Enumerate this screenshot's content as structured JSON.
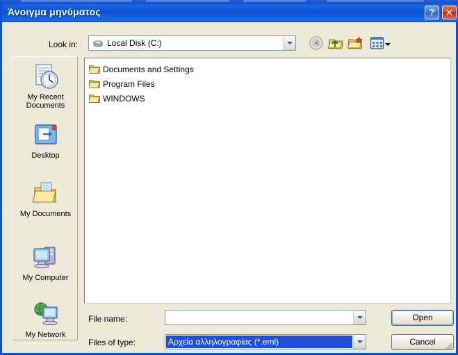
{
  "window": {
    "title": "Άνοιγμα μηνύματος",
    "help_button_label": "?",
    "close_button_label": "✕",
    "accent_color": "#0a4fd4",
    "titlebar_color": "#0b52cf"
  },
  "toolbar": {
    "lookin_label": "Look in:",
    "lookin_value": "Local Disk (C:)",
    "buttons": [
      {
        "name": "back-button",
        "label": "Back",
        "enabled": false
      },
      {
        "name": "up-one-level-button",
        "label": "Up One Level",
        "enabled": true
      },
      {
        "name": "create-new-folder-button",
        "label": "Create New Folder",
        "enabled": true
      },
      {
        "name": "views-button",
        "label": "Views",
        "enabled": true
      }
    ]
  },
  "places": {
    "items": [
      {
        "label": "My Recent Documents",
        "icon": "recent-documents-icon"
      },
      {
        "label": "Desktop",
        "icon": "desktop-icon"
      },
      {
        "label": "My Documents",
        "icon": "my-documents-icon"
      },
      {
        "label": "My Computer",
        "icon": "my-computer-icon"
      },
      {
        "label": "My Network",
        "icon": "my-network-icon"
      }
    ]
  },
  "file_list": {
    "items": [
      {
        "name": "Documents and Settings",
        "type": "folder"
      },
      {
        "name": "Program Files",
        "type": "folder"
      },
      {
        "name": "WINDOWS",
        "type": "folder"
      }
    ]
  },
  "fields": {
    "file_name_label": "File name:",
    "file_name_value": "",
    "file_name_placeholder": "",
    "files_of_type_label": "Files of type:",
    "files_of_type_value": "Αρχεία αλληλογραφίας (*.eml)",
    "selection_color": "#1f4fd8"
  },
  "actions": {
    "open_label": "Open",
    "cancel_label": "Cancel"
  }
}
